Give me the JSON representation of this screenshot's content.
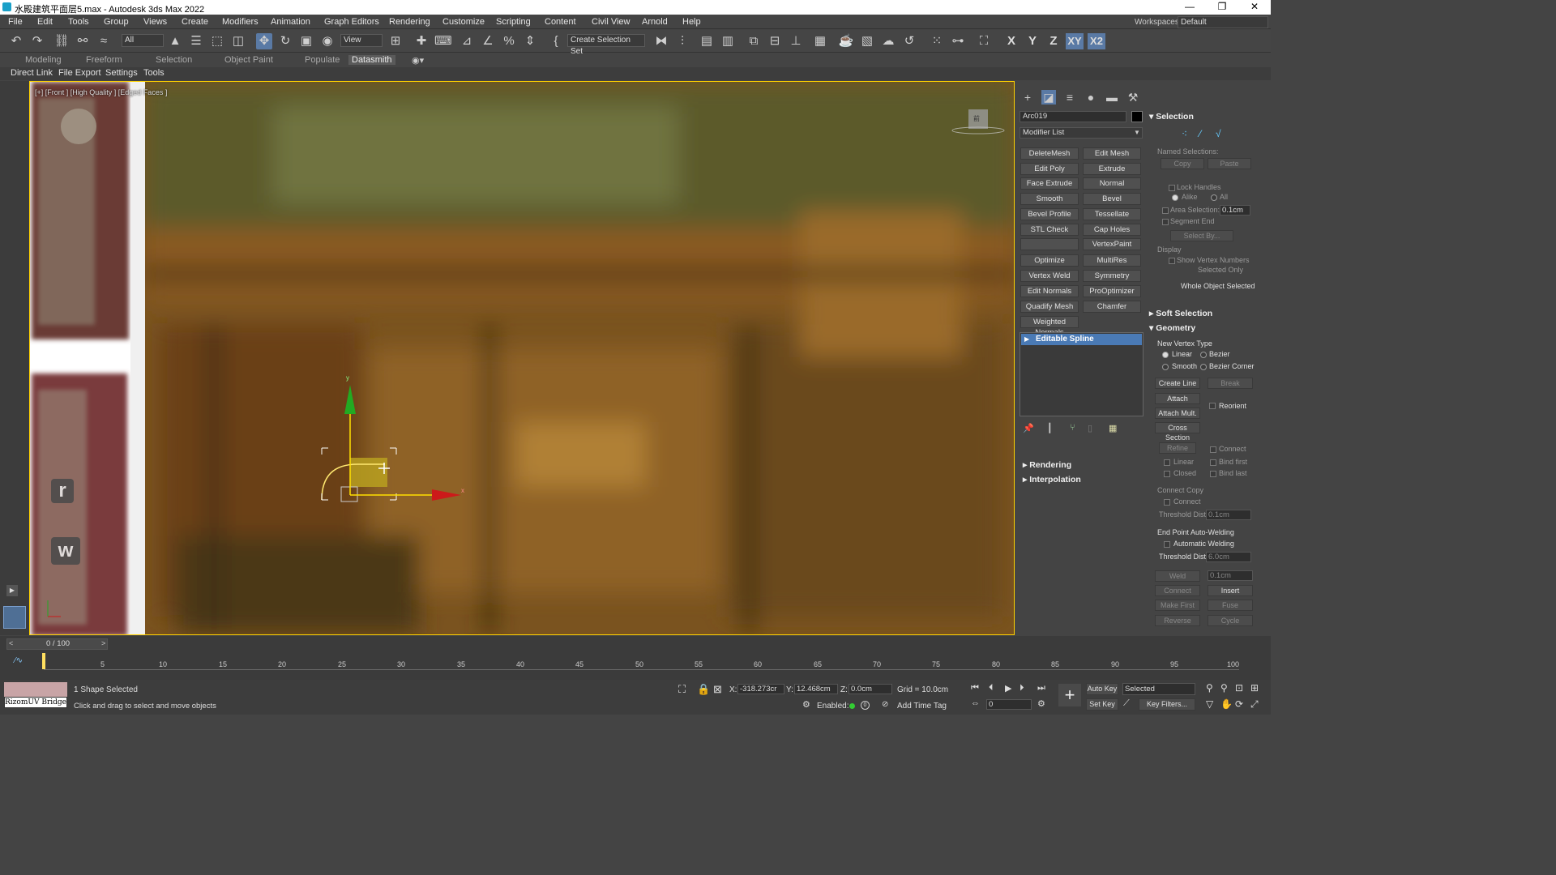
{
  "window": {
    "title": "水殿建筑平面层5.max - Autodesk 3ds Max 2022",
    "minimize": "—",
    "restore": "❐",
    "close": "✕"
  },
  "menu": [
    "File",
    "Edit",
    "Tools",
    "Group",
    "Views",
    "Create",
    "Modifiers",
    "Animation",
    "Graph Editors",
    "Rendering",
    "Customize",
    "Scripting",
    "Content",
    "Civil View",
    "Arnold",
    "Help"
  ],
  "workspace": {
    "label": "Workspaces:",
    "value": "Default"
  },
  "toolbar": {
    "filter_value": "All",
    "refcoord_value": "View",
    "selection_set": "Create Selection Set",
    "axis_x": "X",
    "axis_y": "Y",
    "axis_z": "Z",
    "axis_xy": "XY",
    "axis_xz": "X2"
  },
  "ribbon_tabs": [
    "Modeling",
    "Freeform",
    "Selection",
    "Object Paint",
    "Populate",
    "Datasmith"
  ],
  "ribbon_active": "Datasmith",
  "submenu": [
    "Direct Link",
    "File Export",
    "Settings",
    "Tools"
  ],
  "viewport": {
    "label": "[+] [Front ] [High Quality ] [Edged Faces ]",
    "gizmo_y": "y",
    "gizmo_x": "x",
    "viewcube_label": "前"
  },
  "left_thumbs": {
    "letter_r": "r",
    "letter_w": "w"
  },
  "command_panel": {
    "object_name": "Arc019",
    "modifier_list": "Modifier List",
    "modifier_buttons": [
      [
        "DeleteMesh",
        "Edit Mesh"
      ],
      [
        "Edit Poly",
        "Extrude"
      ],
      [
        "Face Extrude",
        "Normal"
      ],
      [
        "Smooth",
        "Bevel"
      ],
      [
        "Bevel Profile",
        "Tessellate"
      ],
      [
        "STL Check",
        "Cap Holes"
      ],
      [
        "",
        "VertexPaint"
      ],
      [
        "Optimize",
        "MultiRes"
      ],
      [
        "Vertex Weld",
        "Symmetry"
      ],
      [
        "Edit Normals",
        "ProOptimizer"
      ],
      [
        "Quadify Mesh",
        "Chamfer"
      ]
    ],
    "weighted_normals": "Weighted Normals",
    "stack_item": "Editable Spline",
    "rollouts": {
      "rendering": "Rendering",
      "interpolation": "Interpolation"
    }
  },
  "selection_rollout": {
    "title": "Selection",
    "named_selections": "Named Selections:",
    "copy": "Copy",
    "paste": "Paste",
    "lock_handles": "Lock Handles",
    "alike": "Alike",
    "all": "All",
    "area_selection": "Area Selection:",
    "area_value": "0.1cm",
    "segment_end": "Segment End",
    "select_by": "Select By...",
    "display": "Display",
    "show_vertex_numbers": "Show Vertex Numbers",
    "selected_only": "Selected Only",
    "whole_object": "Whole Object Selected"
  },
  "soft_selection": {
    "title": "Soft Selection"
  },
  "geometry": {
    "title": "Geometry",
    "new_vertex_type": "New Vertex Type",
    "linear": "Linear",
    "bezier": "Bezier",
    "smooth": "Smooth",
    "bezier_corner": "Bezier Corner",
    "create_line": "Create Line",
    "break": "Break",
    "attach": "Attach",
    "reorient": "Reorient",
    "attach_mult": "Attach Mult.",
    "cross_section": "Cross Section",
    "refine": "Refine",
    "connect": "Connect",
    "linear2": "Linear",
    "bind_first": "Bind first",
    "closed": "Closed",
    "bind_last": "Bind last",
    "connect_copy": "Connect Copy",
    "connect2": "Connect",
    "threshold_dist": "Threshold Dist",
    "threshold_val1": "0.1cm",
    "end_point": "End Point Auto-Welding",
    "auto_weld": "Automatic Welding",
    "threshold_dist2": "Threshold Dist",
    "threshold_val2": "6.0cm",
    "weld": "Weld",
    "weld_val": "0.1cm",
    "connect3": "Connect",
    "insert": "Insert",
    "make_first": "Make First",
    "fuse": "Fuse",
    "reverse": "Reverse",
    "cycle": "Cycle"
  },
  "timeline": {
    "frame": "0 / 100",
    "ticks": [
      "5",
      "10",
      "15",
      "20",
      "25",
      "30",
      "35",
      "40",
      "45",
      "50",
      "55",
      "60",
      "65",
      "70",
      "75",
      "80",
      "85",
      "90",
      "95",
      "100"
    ]
  },
  "status": {
    "selected": "1 Shape Selected",
    "prompt": "Click and drag to select and move objects",
    "bridge": "RizomUV Bridge",
    "x_label": "X:",
    "x_value": "-318.273cr",
    "y_label": "Y:",
    "y_value": "12.468cm",
    "z_label": "Z:",
    "z_value": "0.0cm",
    "grid": "Grid = 10.0cm",
    "enabled": "Enabled:",
    "add_time_tag": "Add Time Tag",
    "auto_key": "Auto Key",
    "set_key": "Set Key",
    "key_mode": "Selected",
    "key_filters": "Key Filters...",
    "frame_field": "0"
  },
  "colors": {
    "viewport_border": "#ffd200",
    "gizmo_y": "#22aa22",
    "gizmo_x": "#cc1a1a",
    "selected_stack": "#4a7ab5"
  }
}
